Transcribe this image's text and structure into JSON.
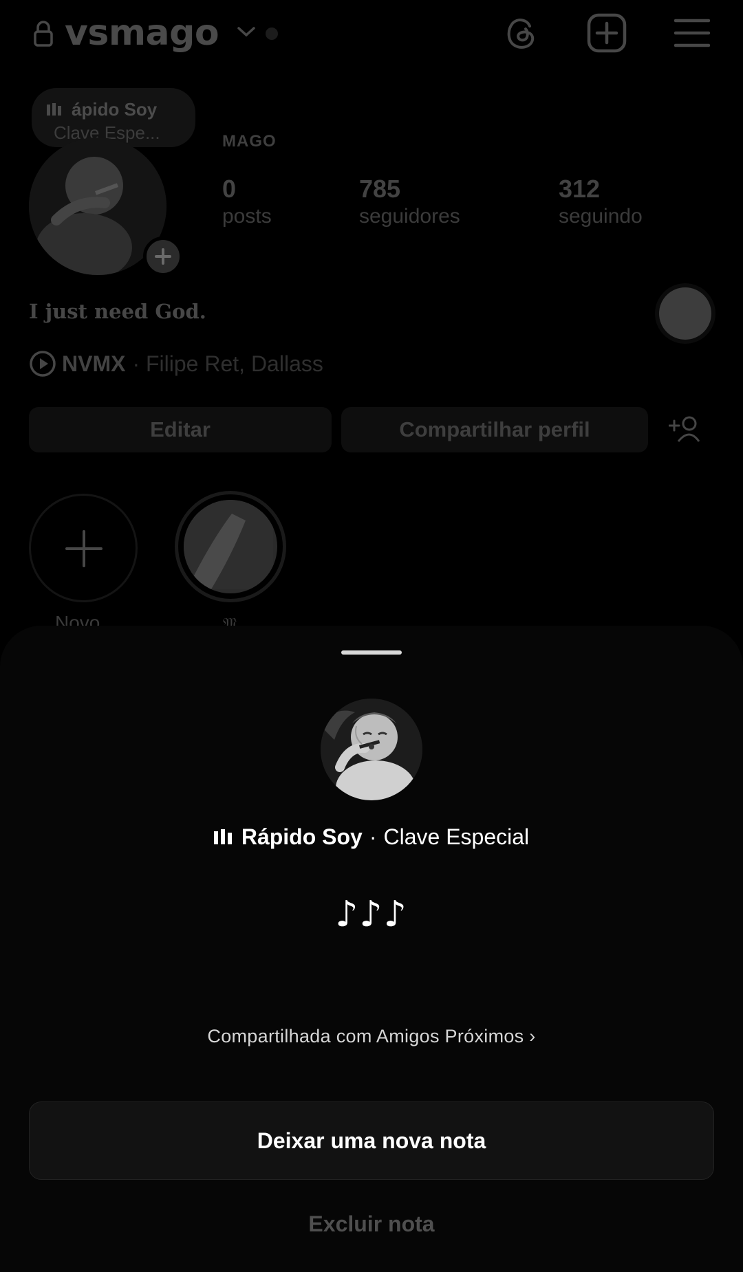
{
  "header": {
    "username": "vsmago",
    "icons": [
      "lock-icon",
      "chevron-down-icon",
      "threads-icon",
      "create-post-icon",
      "menu-icon"
    ]
  },
  "profile": {
    "note_bubble": {
      "line1": "ápido Soy",
      "line2": "Clave Espe..."
    },
    "name": "MAGO",
    "stats": [
      {
        "value": "0",
        "label": "posts"
      },
      {
        "value": "785",
        "label": "seguidores"
      },
      {
        "value": "312",
        "label": "seguindo"
      }
    ],
    "bio": "I just need God.",
    "music": {
      "track": "NVMX",
      "artist": "· Filipe Ret, Dallass"
    },
    "buttons": {
      "edit": "Editar",
      "share": "Compartilhar perfil"
    },
    "highlights": [
      {
        "label": "Novo"
      },
      {
        "label": "𝔐"
      }
    ]
  },
  "sheet": {
    "song_title": "Rápido Soy",
    "separator": "·",
    "song_artist": "Clave Especial",
    "note_text": "♪♪♪",
    "shared_with": "Compartilhada com Amigos Próximos ›",
    "new_note_label": "Deixar uma nova nota",
    "delete_note_label": "Excluir nota"
  },
  "colors": {
    "background": "#000000",
    "sheet": "#060606",
    "text": "#ffffff",
    "dim_text": "#4f4f4f"
  }
}
